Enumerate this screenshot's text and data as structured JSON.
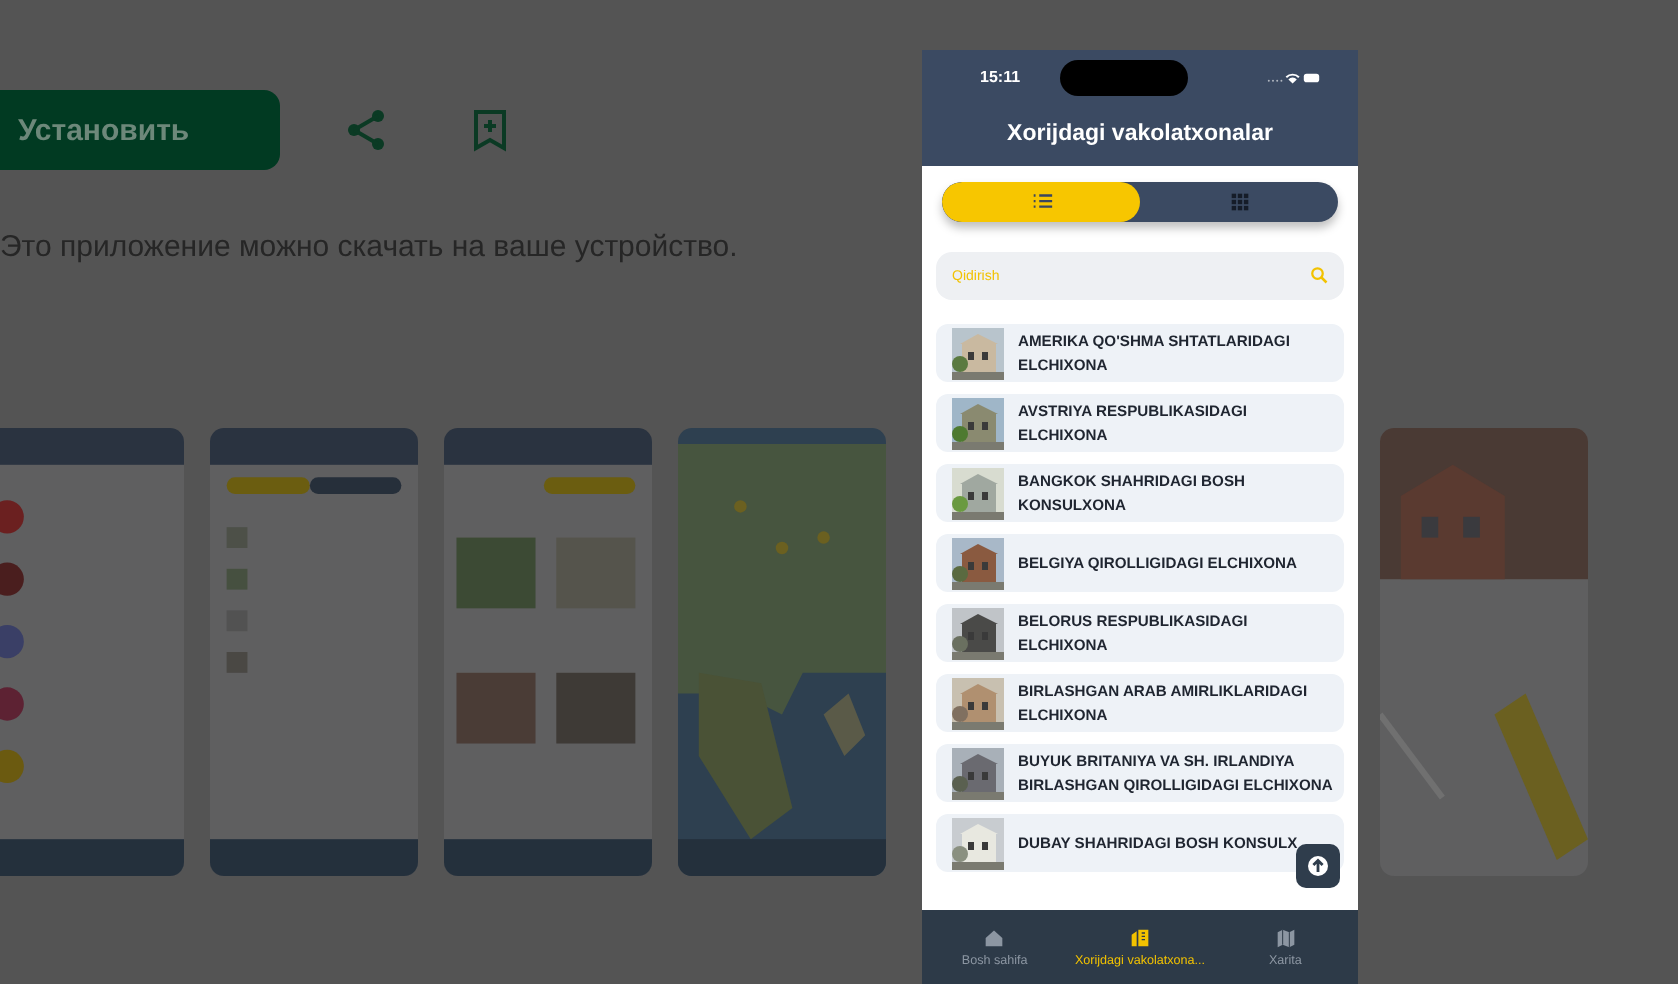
{
  "store_page": {
    "install_button": "Установить",
    "availability_note": "Это приложение можно скачать на ваше устройство."
  },
  "screenshot_viewer": {
    "status_time": "15:11",
    "title": "Xorijdagi vakolatxonalar",
    "view_toggle": [
      {
        "kind": "list",
        "selected": true
      },
      {
        "kind": "grid",
        "selected": false
      }
    ],
    "search": {
      "placeholder": "Qidirish"
    },
    "items": [
      {
        "name": "AMERIKA QO'SHMA SHTATLARIDAGI ELCHIXONA"
      },
      {
        "name": "AVSTRIYA RESPUBLIKASIDAGI ELCHIXONA"
      },
      {
        "name": "BANGKOK SHAHRIDAGI BOSH KONSULXONA"
      },
      {
        "name": "BELGIYA QIROLLIGIDAGI ELCHIXONA"
      },
      {
        "name": "BELORUS RESPUBLIKASIDAGI ELCHIXONA"
      },
      {
        "name": "BIRLASHGAN ARAB AMIRLIKLARIDAGI ELCHIXONA"
      },
      {
        "name": "BUYUK BRITANIYA VA SH. IRLANDIYA BIRLASHGAN QIROLLIGIDAGI ELCHIXONA"
      },
      {
        "name": "DUBAY SHAHRIDAGI BOSH KONSULX"
      }
    ],
    "nav": [
      {
        "kind": "home",
        "label": "Bosh sahifa",
        "selected": false
      },
      {
        "kind": "building",
        "label": "Xorijdagi vakolatxona...",
        "selected": true
      },
      {
        "kind": "map",
        "label": "Xarita",
        "selected": false
      }
    ]
  }
}
